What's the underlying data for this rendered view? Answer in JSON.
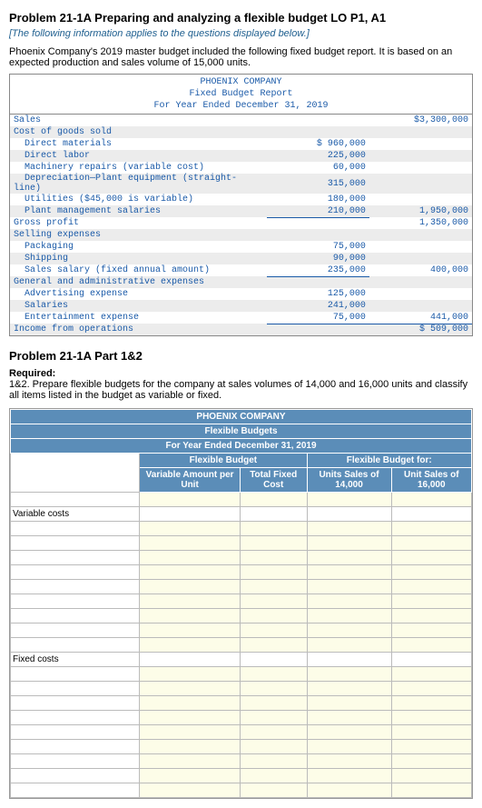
{
  "problem_title": "Problem 21-1A Preparing and analyzing a flexible budget LO P1, A1",
  "instruction": "[The following information applies to the questions displayed below.]",
  "intro": "Phoenix Company's 2019 master budget included the following fixed budget report. It is based on an expected production and sales volume of 15,000 units.",
  "report": {
    "company": "PHOENIX COMPANY",
    "title": "Fixed Budget Report",
    "period": "For Year Ended December 31, 2019",
    "rows": [
      {
        "label": "Sales",
        "col1": "",
        "col2": "$3,300,000",
        "cls": ""
      },
      {
        "label": "Cost of goods sold",
        "col1": "",
        "col2": "",
        "cls": "shade"
      },
      {
        "label": "  Direct materials",
        "col1": "$ 960,000",
        "col2": "",
        "cls": ""
      },
      {
        "label": "  Direct labor",
        "col1": "225,000",
        "col2": "",
        "cls": "shade"
      },
      {
        "label": "  Machinery repairs (variable cost)",
        "col1": "60,000",
        "col2": "",
        "cls": ""
      },
      {
        "label": "  Depreciation—Plant equipment (straight-line)",
        "col1": "315,000",
        "col2": "",
        "cls": "shade"
      },
      {
        "label": "  Utilities ($45,000 is variable)",
        "col1": "180,000",
        "col2": "",
        "cls": ""
      },
      {
        "label": "  Plant management salaries",
        "col1": "210,000",
        "col2": "1,950,000",
        "cls": "shade",
        "u1": true
      },
      {
        "label": "Gross profit",
        "col1": "",
        "col2": "1,350,000",
        "cls": ""
      },
      {
        "label": "Selling expenses",
        "col1": "",
        "col2": "",
        "cls": "shade"
      },
      {
        "label": "  Packaging",
        "col1": "75,000",
        "col2": "",
        "cls": ""
      },
      {
        "label": "  Shipping",
        "col1": "90,000",
        "col2": "",
        "cls": "shade"
      },
      {
        "label": "  Sales salary (fixed annual amount)",
        "col1": "235,000",
        "col2": "400,000",
        "cls": "",
        "u1": true
      },
      {
        "label": "General and administrative expenses",
        "col1": "",
        "col2": "",
        "cls": "shade"
      },
      {
        "label": "  Advertising expense",
        "col1": "125,000",
        "col2": "",
        "cls": ""
      },
      {
        "label": "  Salaries",
        "col1": "241,000",
        "col2": "",
        "cls": "shade"
      },
      {
        "label": "  Entertainment expense",
        "col1": "75,000",
        "col2": "441,000",
        "cls": "",
        "u1": true,
        "u2": true
      },
      {
        "label": "Income from operations",
        "col1": "",
        "col2": "$  509,000",
        "cls": "shade"
      }
    ]
  },
  "part_title": "Problem 21-1A Part 1&2",
  "required_label": "Required:",
  "required_text": "1&2. Prepare flexible budgets for the company at sales volumes of 14,000 and 16,000 units and classify all items listed in the budget as variable or fixed.",
  "flex": {
    "company": "PHOENIX COMPANY",
    "title": "Flexible Budgets",
    "period": "For Year Ended December 31, 2019",
    "hdr_flex_budget": "Flexible Budget",
    "hdr_flex_for": "Flexible Budget for:",
    "col_var_amt": "Variable Amount per Unit",
    "col_tot_fixed": "Total Fixed Cost",
    "col_14000": "Units Sales of 14,000",
    "col_16000": "Unit Sales of 16,000",
    "section_variable": "Variable costs",
    "section_fixed": "Fixed costs"
  }
}
